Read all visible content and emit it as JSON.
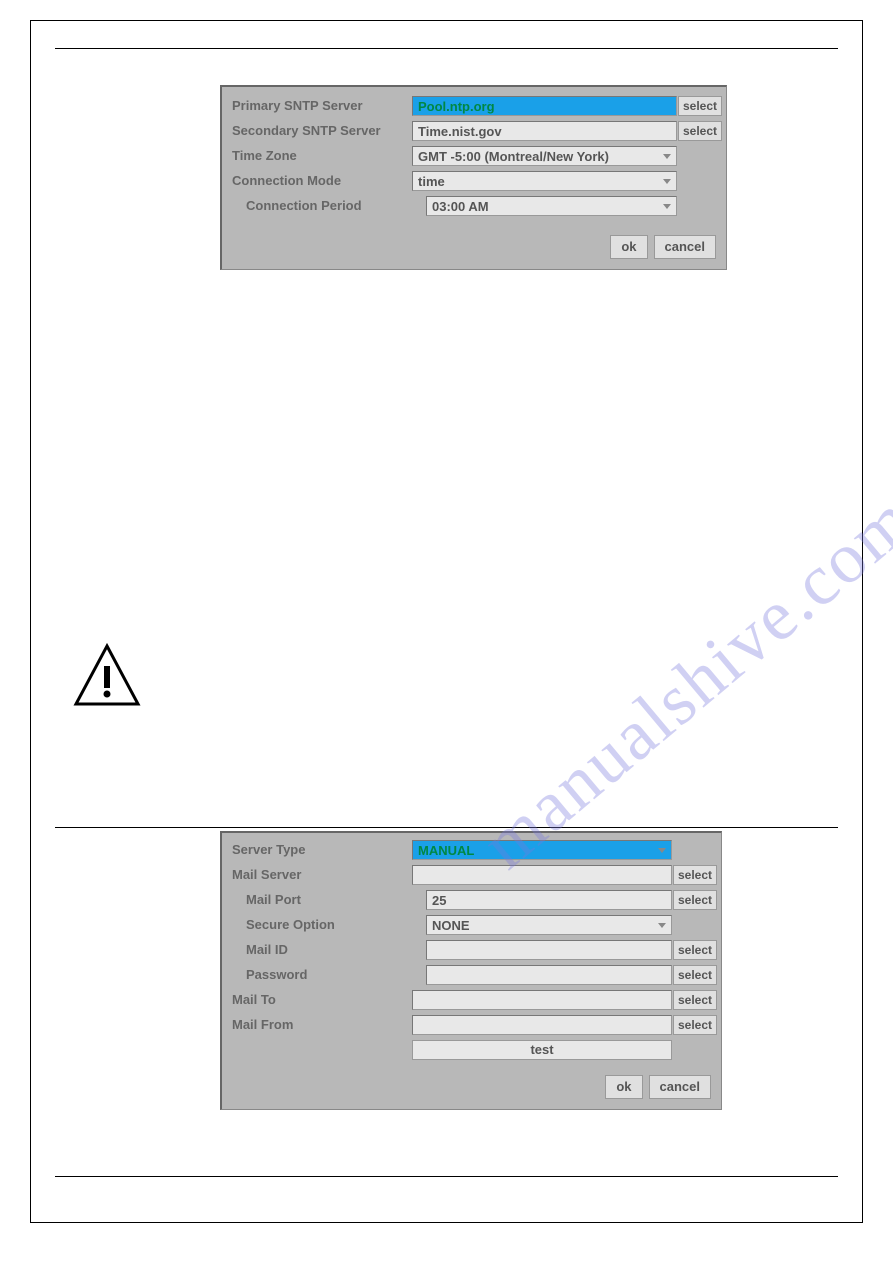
{
  "watermark": "manualshive.com",
  "panel1": {
    "rows": [
      {
        "label": "Primary SNTP Server",
        "value": "Pool.ntp.org",
        "highlight": true,
        "select": true
      },
      {
        "label": "Secondary SNTP Server",
        "value": "Time.nist.gov",
        "select": true
      },
      {
        "label": "Time Zone",
        "value": "GMT -5:00 (Montreal/New York)",
        "dropdown": true
      },
      {
        "label": "Connection Mode",
        "value": "time",
        "dropdown": true
      },
      {
        "label": "Connection Period",
        "value": "03:00 AM",
        "dropdown": true,
        "indent": true
      }
    ],
    "buttons": {
      "ok": "ok",
      "cancel": "cancel"
    },
    "select_label": "select"
  },
  "panel2": {
    "rows": [
      {
        "label": "Server Type",
        "value": "MANUAL",
        "highlight": true,
        "dropdown": true
      },
      {
        "label": "Mail Server",
        "value": "",
        "select": true
      },
      {
        "label": "Mail Port",
        "value": "25",
        "select": true,
        "indent": true
      },
      {
        "label": "Secure Option",
        "value": "NONE",
        "dropdown": true,
        "indent": true
      },
      {
        "label": "Mail ID",
        "value": "",
        "select": true,
        "indent": true
      },
      {
        "label": "Password",
        "value": "",
        "select": true,
        "indent": true
      },
      {
        "label": "Mail To",
        "value": "",
        "select": true
      },
      {
        "label": "Mail From",
        "value": "",
        "select": true
      }
    ],
    "test_label": "test",
    "buttons": {
      "ok": "ok",
      "cancel": "cancel"
    },
    "select_label": "select"
  }
}
